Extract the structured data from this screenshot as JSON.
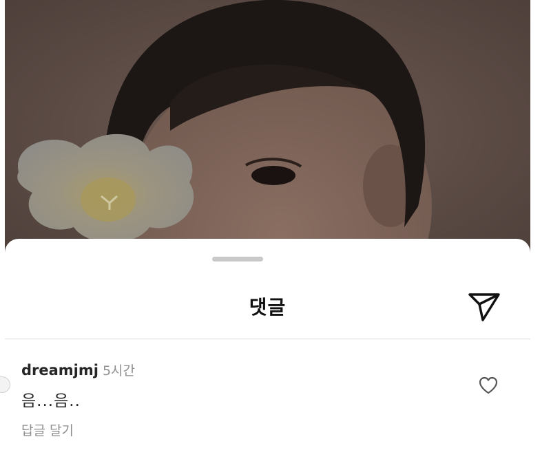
{
  "sheet": {
    "title": "댓글"
  },
  "comment": {
    "username": "dreamjmj",
    "time": "5시간",
    "text": "음...음..",
    "reply_label": "답글 달기"
  },
  "icons": {
    "share": "paper-plane-icon",
    "like": "heart-outline-icon"
  },
  "colors": {
    "sheet_bg": "#ffffff",
    "secondary_text": "#8e8e8e",
    "primary_text": "#262626"
  }
}
